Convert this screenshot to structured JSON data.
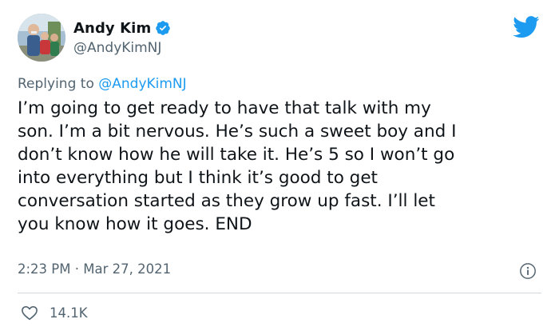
{
  "tweet": {
    "author": {
      "display_name": "Andy Kim",
      "handle": "@AndyKimNJ",
      "avatar_icon": "profile-photo",
      "verified_icon": "verified-badge-icon"
    },
    "brand_icon": "twitter-bird-icon",
    "replying_to": {
      "prefix": "Replying to",
      "mention": "@AndyKimNJ"
    },
    "text": "I’m going to get ready to have that talk with my\nson. I’m a bit nervous. He’s such a sweet boy and I\ndon’t know how he will take it. He’s 5 so I won’t go\ninto everything but I think it’s good to get\nconversation started as they grow up fast. I’ll let\nyou know how it goes. END",
    "time": "2:23 PM",
    "separator": "·",
    "date": "Mar 27, 2021",
    "info_icon": "info-icon",
    "likes": {
      "icon": "heart-icon",
      "count": "14.1K"
    }
  },
  "colors": {
    "text_primary": "#0f1419",
    "text_secondary": "#536471",
    "accent": "#1d9bf0",
    "divider": "#cfd9de"
  }
}
